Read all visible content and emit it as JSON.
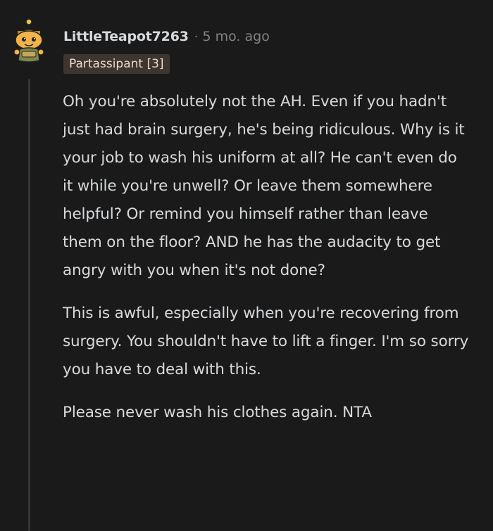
{
  "comment": {
    "username": "LittleTeapot7263",
    "separator": "·",
    "time": "5 mo. ago",
    "flair": "Partassipant [3]",
    "paragraphs": [
      "Oh you're absolutely not the AH. Even if you hadn't just had brain surgery, he's being ridiculous. Why is it your job to wash his uniform at all? He can't even do it while you're unwell? Or leave them somewhere helpful? Or remind you himself rather than leave them on the floor? AND he has the audacity to get angry with you when it's not done?",
      "This is awful, especially when you're recovering from surgery. You shouldn't have to lift a finger. I'm so sorry you have to deal with this.",
      "Please never wash his clothes again. NTA"
    ]
  },
  "colors": {
    "background": "#1a1a1b",
    "text": "#d7dadc",
    "meta": "#818384",
    "flair_bg": "#3d3530",
    "thread_line": "#343536"
  },
  "icons": {
    "avatar": "snoo-teapot-avatar-icon"
  }
}
